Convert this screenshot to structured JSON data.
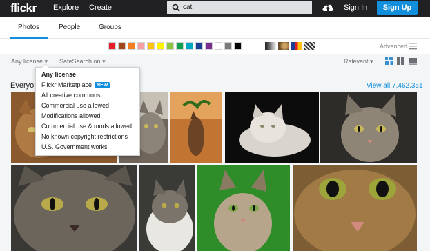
{
  "header": {
    "logo": "flickr",
    "nav": [
      "Explore",
      "Create"
    ],
    "search_value": "cat",
    "sign_in": "Sign In",
    "sign_up": "Sign Up"
  },
  "tabs": [
    {
      "label": "Photos",
      "active": true
    },
    {
      "label": "People",
      "active": false
    },
    {
      "label": "Groups",
      "active": false
    }
  ],
  "color_swatches": [
    "#e31e26",
    "#a0471a",
    "#f47f20",
    "#f8a1a4",
    "#fec20f",
    "#fff200",
    "#8cc63e",
    "#0d9f4a",
    "#00a7c5",
    "#1c3f95",
    "#7b2c8f",
    "#ffffff",
    "#7a7a7a",
    "#000000"
  ],
  "style_patterns": [
    "black-white",
    "shallow-depth",
    "minimalist",
    "patterns"
  ],
  "advanced_label": "Advanced",
  "filters": {
    "license": "Any license",
    "safesearch": "SafeSearch on",
    "sort": "Relevant"
  },
  "results_title": "Everyone",
  "view_all": "View all 7,462,351",
  "license_menu": {
    "items": [
      {
        "label": "Any license",
        "selected": true
      },
      {
        "label": "Flickr Marketplace",
        "badge": "NEW"
      },
      {
        "label": "All creative commons"
      },
      {
        "label": "Commercial use allowed"
      },
      {
        "label": "Modifications allowed"
      },
      {
        "label": "Commercial use & mods allowed"
      },
      {
        "label": "No known copyright restrictions"
      },
      {
        "label": "U.S. Government works"
      }
    ]
  },
  "photos": [
    {
      "row": 1,
      "subject": "tabby cat",
      "bg": "#8a5a2e"
    },
    {
      "row": 1,
      "subject": "tabby cat close-up",
      "bg": "#6f655b"
    },
    {
      "row": 1,
      "subject": "cat leaping at plant",
      "bg": "#b8672b"
    },
    {
      "row": 1,
      "subject": "fluffy white cat on black",
      "bg": "#0d0c0c"
    },
    {
      "row": 1,
      "subject": "tabby cat portrait",
      "bg": "#4b4a44"
    },
    {
      "row": 2,
      "subject": "tabby face close-up",
      "bg": "#3a3834"
    },
    {
      "row": 2,
      "subject": "tabby and white cat",
      "bg": "#3a3a36"
    },
    {
      "row": 2,
      "subject": "tabby cat on green",
      "bg": "#2e8d28"
    },
    {
      "row": 2,
      "subject": "cat eyes close-up",
      "bg": "#7c5d34"
    }
  ]
}
